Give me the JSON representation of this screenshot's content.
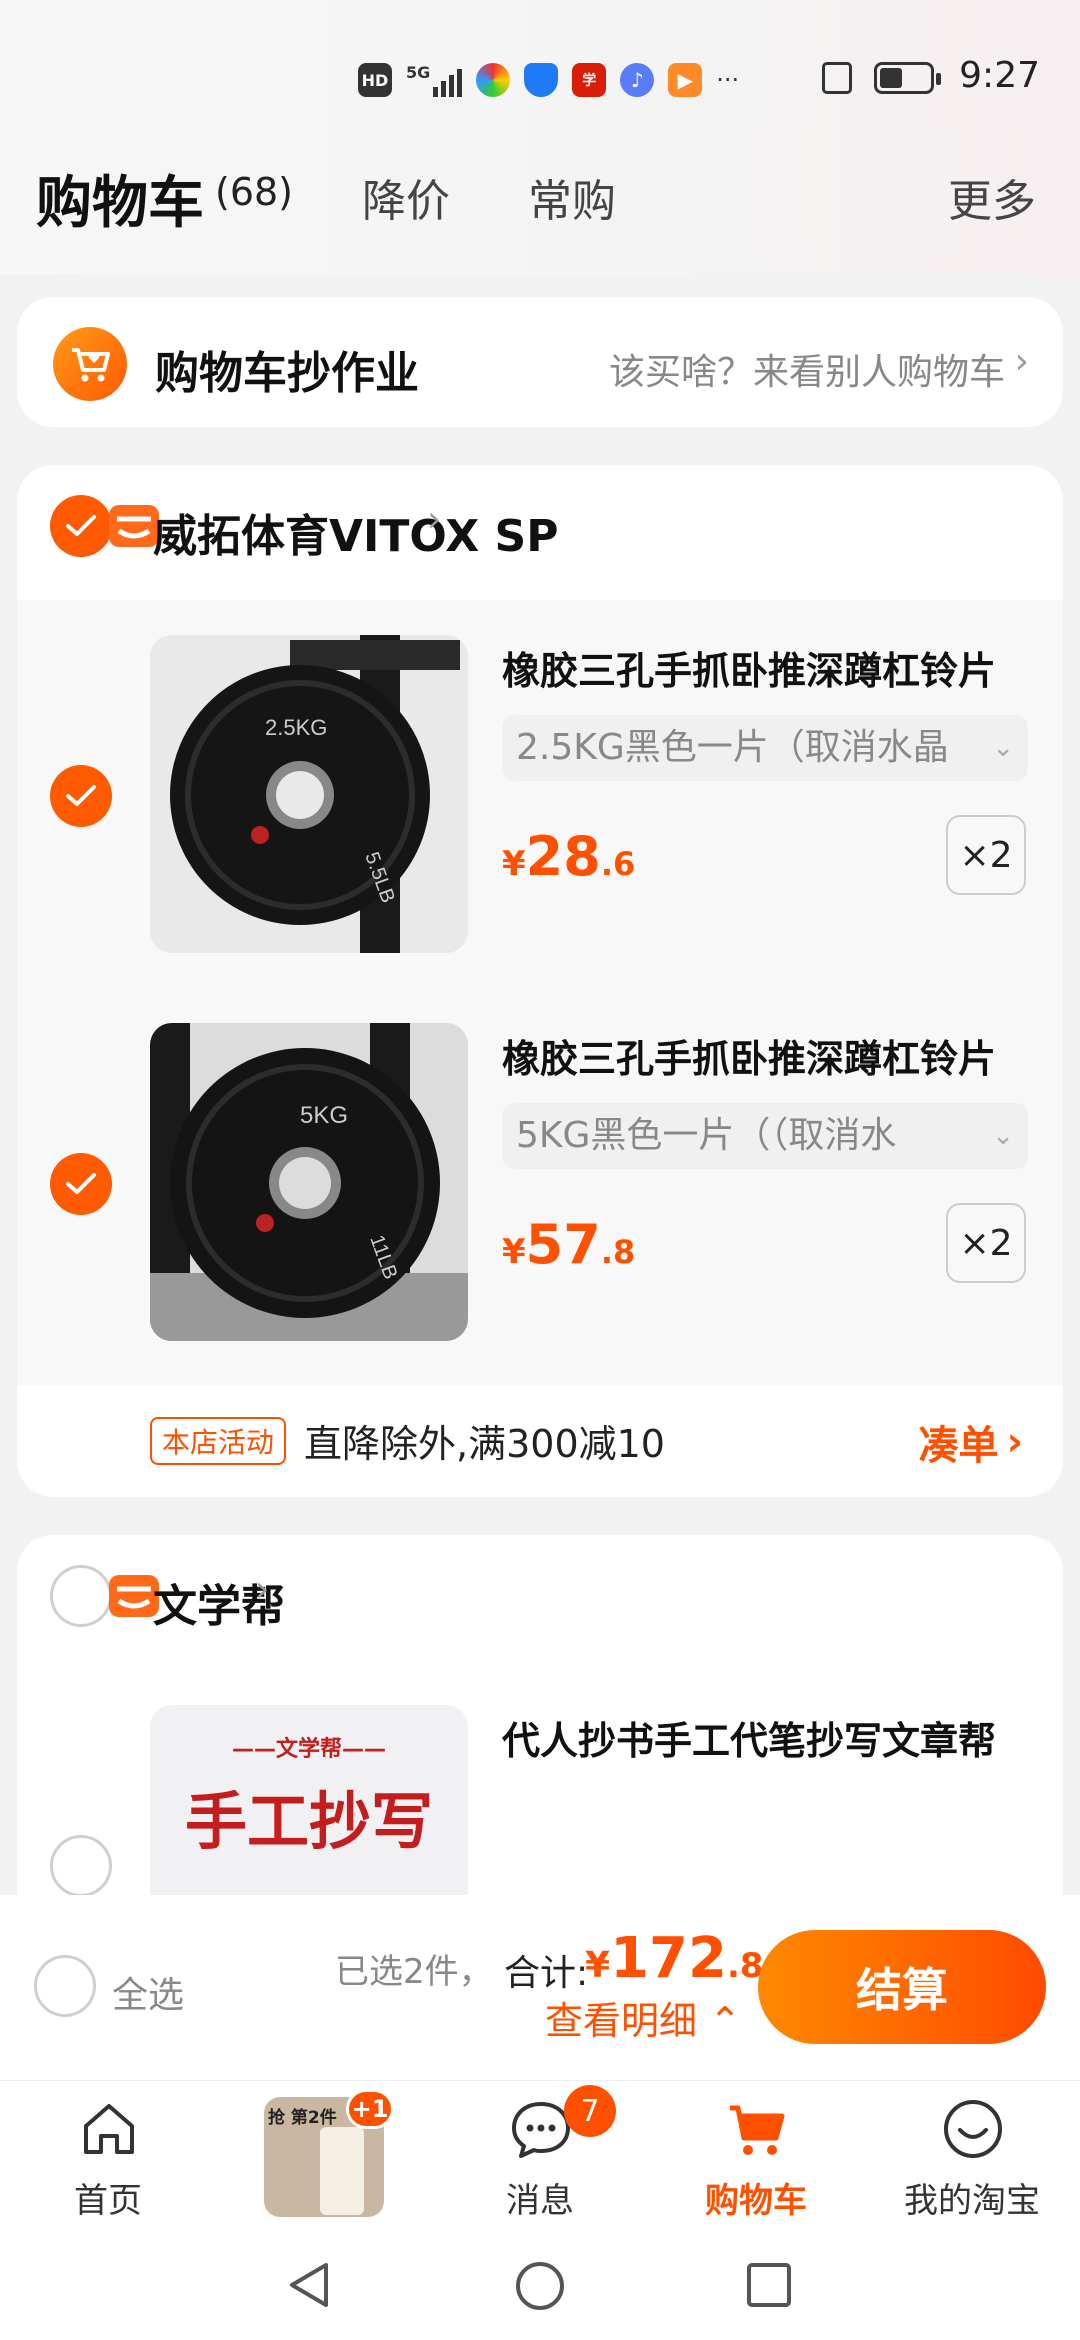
{
  "status_bar": {
    "time": "9:27",
    "network": "5G"
  },
  "header": {
    "title": "购物车",
    "count": "(68)",
    "tabs": [
      "降价",
      "常购"
    ],
    "more": "更多"
  },
  "promo": {
    "title": "购物车抄作业",
    "link": "该买啥？来看别人购物车"
  },
  "shops": [
    {
      "name": "威拓体育VITOX SP",
      "checked": true,
      "items": [
        {
          "title": "橡胶三孔手抓卧推深蹲杠铃片",
          "sku": "2.5KG黑色一片（取消水晶",
          "price_symbol": "¥",
          "price_int": "28",
          "price_dec": ".6",
          "qty": "×2",
          "plate_label": "2.5KG",
          "plate_lb": "5.5LB"
        },
        {
          "title": "橡胶三孔手抓卧推深蹲杠铃片",
          "sku": "5KG黑色一片（（取消水",
          "price_symbol": "¥",
          "price_int": "57",
          "price_dec": ".8",
          "qty": "×2",
          "plate_label": "5KG",
          "plate_lb": "11LB"
        }
      ],
      "activity": {
        "tag": "本店活动",
        "text": "直降除外,满300减10",
        "link": "凑单"
      }
    },
    {
      "name": "文学帮",
      "checked": false,
      "items": [
        {
          "title": "代人抄书手工代笔抄写文章帮",
          "thumb_small": "——文学帮——",
          "thumb_big": "手工抄写"
        }
      ]
    }
  ],
  "bottom": {
    "select_all": "全选",
    "selected": "已选2件，",
    "total_label": "合计:",
    "total_symbol": "¥",
    "total_int": "172",
    "total_dec": ".80",
    "detail": "查看明细",
    "checkout": "结算"
  },
  "tabbar": {
    "items": [
      {
        "label": "首页"
      },
      {
        "label": "",
        "badge": "+1",
        "thumb_text": "抢 第2件"
      },
      {
        "label": "消息",
        "badge": "7"
      },
      {
        "label": "购物车"
      },
      {
        "label": "我的淘宝"
      }
    ]
  },
  "colors": {
    "accent": "#ff5000",
    "checkbox": "#ff5a00"
  }
}
